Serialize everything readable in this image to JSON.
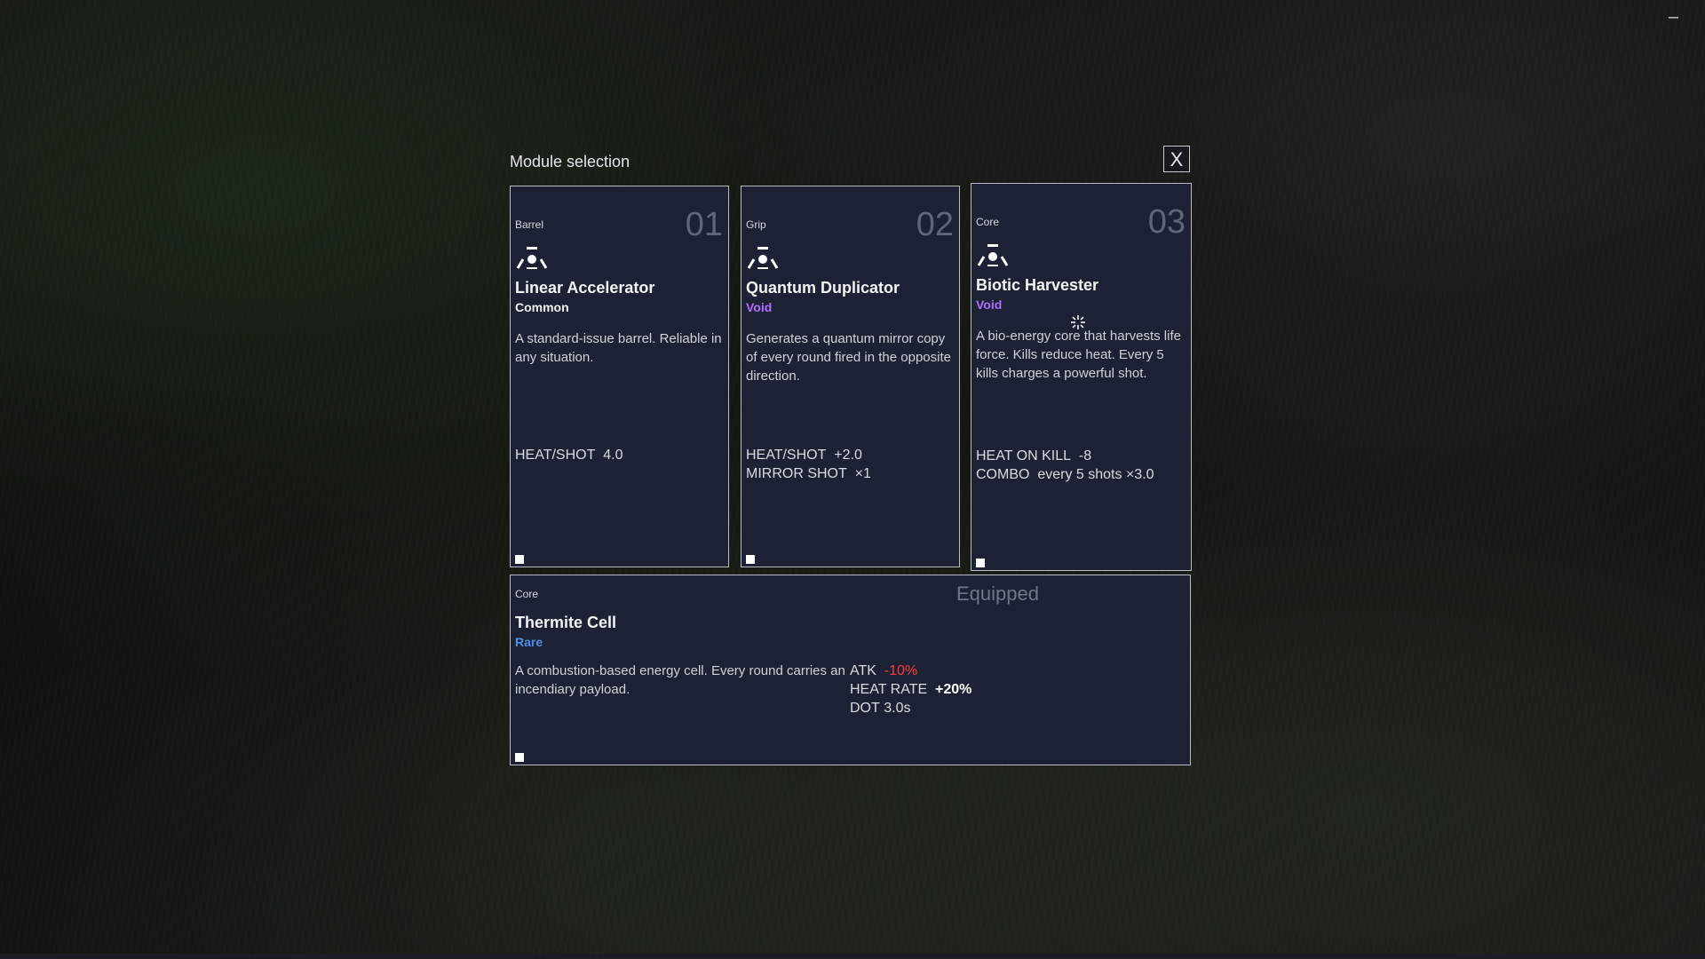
{
  "window": {
    "minimize_glyph": "–"
  },
  "dialog": {
    "title": "Module selection",
    "close_label": "X"
  },
  "cards": [
    {
      "category": "Barrel",
      "number": "01",
      "icon": "module-icon",
      "name": "Linear Accelerator",
      "rarity": "Common",
      "rarity_color": "#f0f1f3",
      "description": "A standard-issue barrel. Reliable in any situation.",
      "stats": [
        {
          "label": "HEAT/SHOT",
          "value": "4.0"
        }
      ]
    },
    {
      "category": "Grip",
      "number": "02",
      "icon": "module-icon",
      "name": "Quantum Duplicator",
      "rarity": "Void",
      "rarity_color": "#b070ff",
      "description": "Generates a quantum mirror copy of every round fired in the opposite direction.",
      "stats": [
        {
          "label": "HEAT/SHOT",
          "value": "+2.0"
        },
        {
          "label": "MIRROR SHOT",
          "value": "×1"
        }
      ]
    },
    {
      "category": "Core",
      "number": "03",
      "icon": "module-icon",
      "name": "Biotic Harvester",
      "rarity": "Void",
      "rarity_color": "#b070ff",
      "description": "A bio-energy core that harvests life force. Kills reduce heat. Every 5 kills charges a powerful shot.",
      "stats": [
        {
          "label": "HEAT ON KILL",
          "value": "-8"
        },
        {
          "label": "COMBO",
          "value": "every 5 shots ×3.0"
        }
      ]
    }
  ],
  "equipped": {
    "category": "Core",
    "status": "Equipped",
    "name": "Thermite Cell",
    "rarity": "Rare",
    "rarity_color": "#4f8fe8",
    "description": "A combustion-based energy cell. Every round carries an incendiary payload.",
    "stats": [
      {
        "label": "ATK",
        "value": "-10%",
        "tone": "negative"
      },
      {
        "label": "HEAT RATE",
        "value": "+20%",
        "tone": "positive"
      },
      {
        "label": "DOT",
        "value": "3.0s",
        "tone": "neutral"
      }
    ]
  },
  "colors": {
    "panel_bg": "#1c2233",
    "border": "#b9bcc4",
    "negative": "#ff3a3a",
    "void": "#b070ff",
    "rare": "#4f8fe8"
  }
}
